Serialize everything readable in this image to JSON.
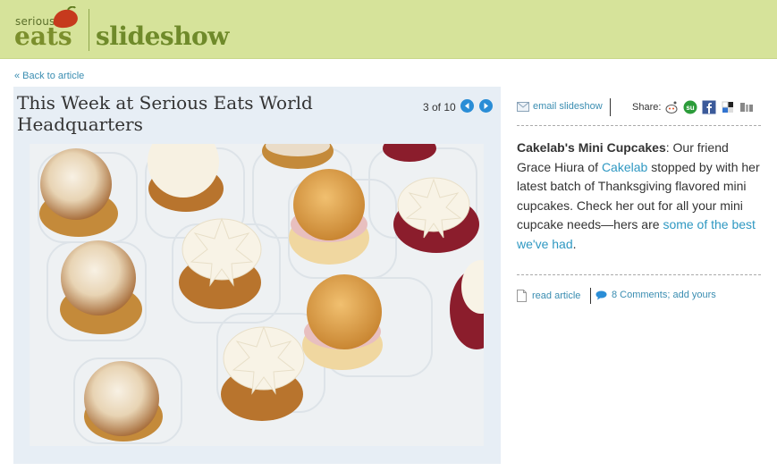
{
  "header": {
    "logo_small": "serious",
    "logo_main": "eats",
    "section": "slideshow"
  },
  "back_link": "« Back to article",
  "slide": {
    "title": "This Week at Serious Eats World Headquarters",
    "counter": "3 of 10",
    "photo_alt": "Cakelab's Mini Cupcakes"
  },
  "sidebar": {
    "email_label": "email slideshow",
    "share_label": "Share:",
    "share_icons": [
      "reddit-icon",
      "stumbleupon-icon",
      "facebook-icon",
      "delicious-icon",
      "digg-icon"
    ],
    "description": {
      "bold": "Cakelab's Mini Cupcakes",
      "text1": ": Our friend Grace Hiura of ",
      "link1": "Cakelab",
      "text2": " stopped by with her latest batch of Thanksgiving flavored mini cupcakes. Check her out for all your mini cupcake needs—hers are ",
      "link2": "some of the best we've had",
      "text3": "."
    },
    "read_article": "read article",
    "comments": "8 Comments; add yours"
  },
  "colors": {
    "header_bg": "#d6e39a",
    "panel_bg": "#e7eef5",
    "link": "#3a8db1",
    "nav_button": "#2a8dd6"
  }
}
